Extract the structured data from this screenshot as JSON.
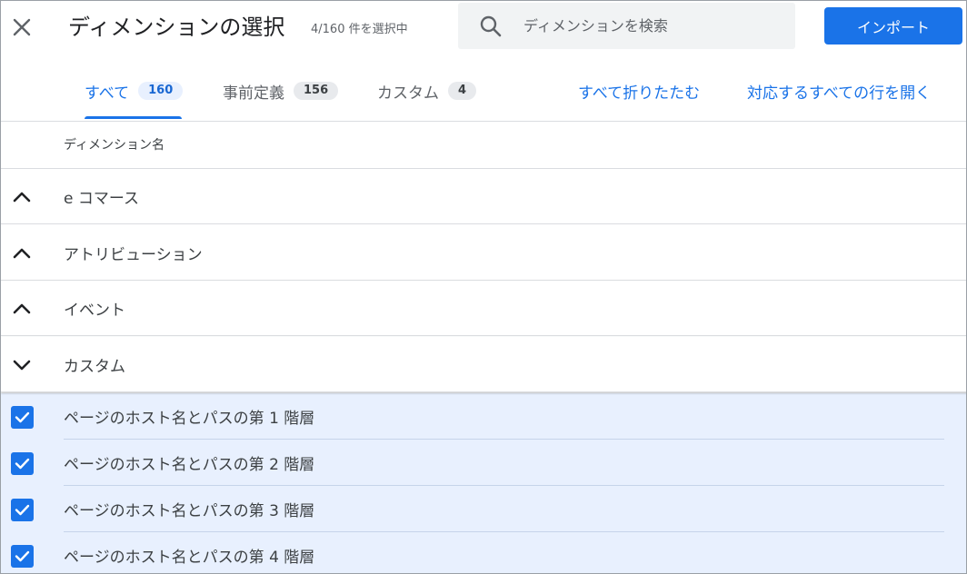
{
  "header": {
    "title": "ディメンションの選択",
    "selection_count": "4/160 件を選択中",
    "search_placeholder": "ディメンションを検索",
    "import_label": "インポート",
    "close_icon": "close-icon",
    "search_icon": "search-icon"
  },
  "tabs": [
    {
      "label": "すべて",
      "count": "160",
      "active": true
    },
    {
      "label": "事前定義",
      "count": "156",
      "active": false
    },
    {
      "label": "カスタム",
      "count": "4",
      "active": false
    }
  ],
  "actions": {
    "collapse_all": "すべて折りたたむ",
    "expand_matching": "対応するすべての行を開く"
  },
  "table": {
    "column_header": "ディメンション名",
    "groups": [
      {
        "label": "e コマース",
        "expanded": false,
        "icon": "chevron-up-icon"
      },
      {
        "label": "アトリビューション",
        "expanded": false,
        "icon": "chevron-up-icon"
      },
      {
        "label": "イベント",
        "expanded": false,
        "icon": "chevron-up-icon"
      },
      {
        "label": "カスタム",
        "expanded": true,
        "icon": "chevron-down-icon"
      }
    ],
    "items": [
      {
        "label": "ページのホスト名とパスの第 1 階層",
        "checked": true
      },
      {
        "label": "ページのホスト名とパスの第 2 階層",
        "checked": true
      },
      {
        "label": "ページのホスト名とパスの第 3 階層",
        "checked": true
      },
      {
        "label": "ページのホスト名とパスの第 4 階層",
        "checked": true
      }
    ]
  },
  "colors": {
    "accent": "#1a73e8",
    "selected_background": "#e8f0fe",
    "search_background": "#f1f3f4",
    "badge_background": "#e8eaed"
  }
}
